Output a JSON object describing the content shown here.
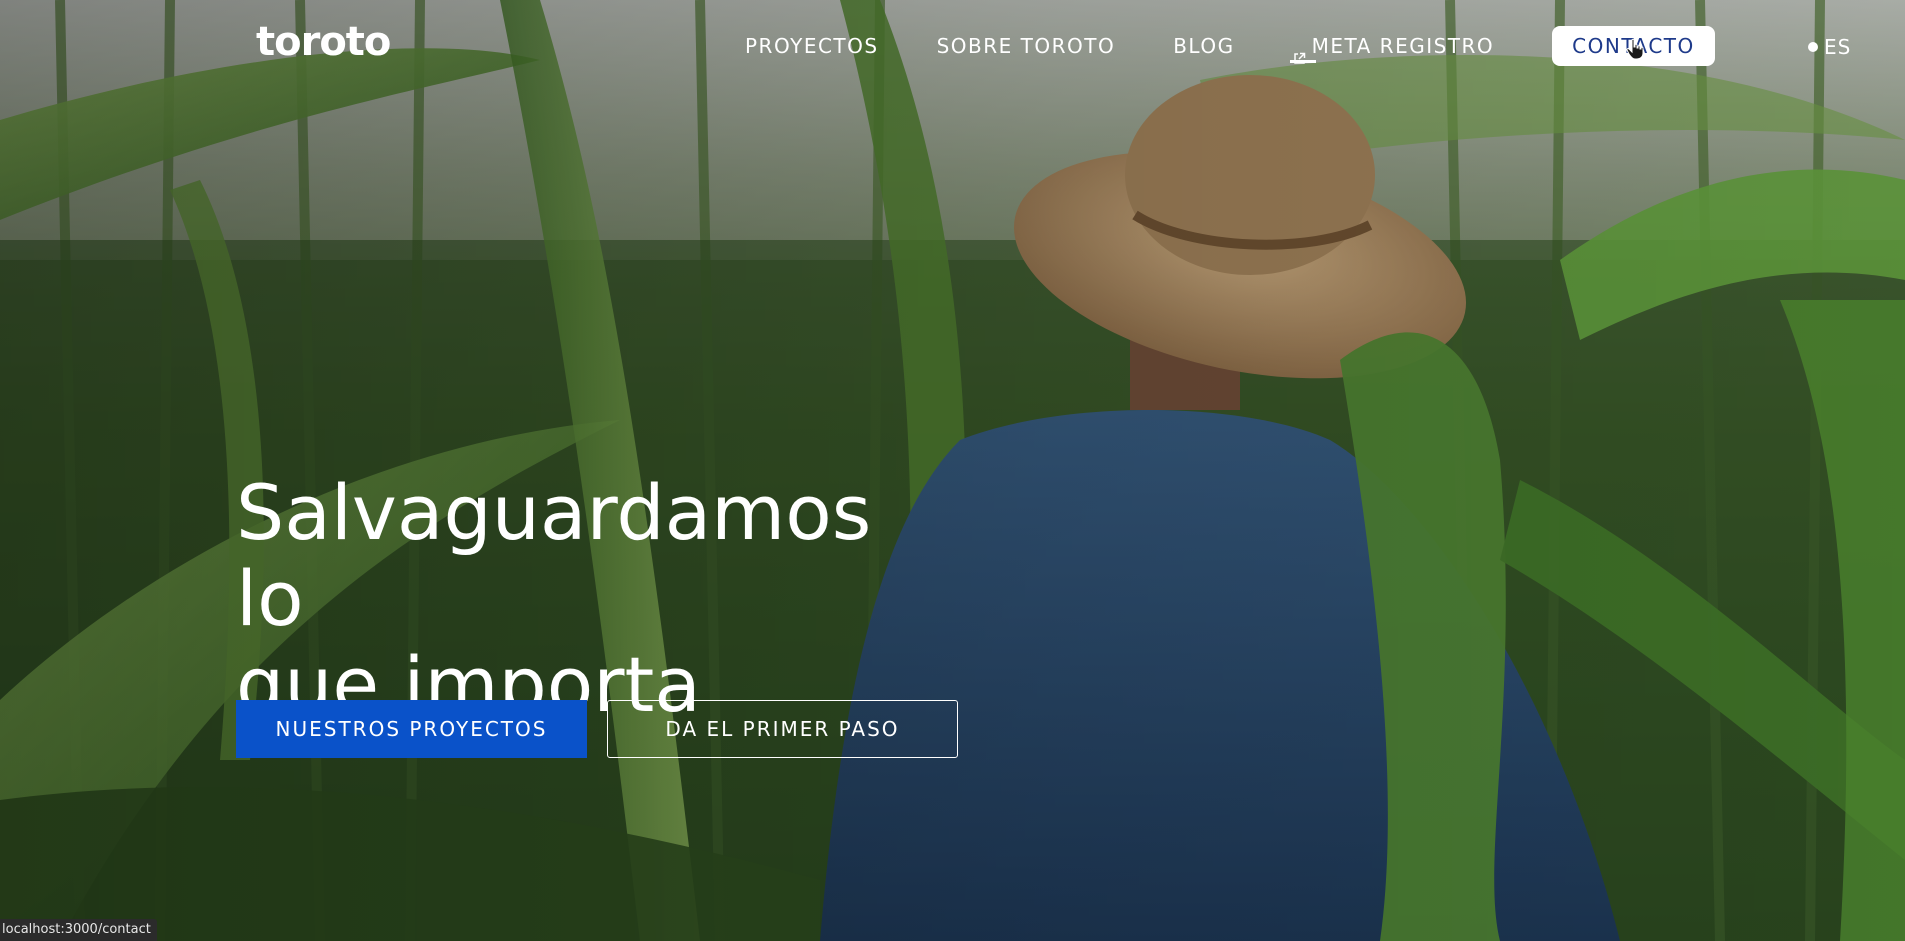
{
  "header": {
    "logo": "toroto",
    "nav": [
      {
        "label": "PROYECTOS"
      },
      {
        "label": "SOBRE TOROTO"
      },
      {
        "label": "BLOG"
      },
      {
        "label": "META REGISTRO",
        "icon": "external-link-icon"
      }
    ],
    "contact_label": "CONTACTO",
    "language": "ES"
  },
  "hero": {
    "title_line1": "Salvaguardamos lo",
    "title_line2": "que importa",
    "primary_cta": "NUESTROS PROYECTOS",
    "secondary_cta": "DA EL PRIMER PASO"
  },
  "status_bar": {
    "url": "localhost:3000/contact"
  },
  "colors": {
    "primary_button": "#0a52c9",
    "contact_text": "#1e3a8a",
    "foliage_dark": "#2e4a22",
    "shirt_blue": "#2a4a6a",
    "hat_tan": "#a88a62"
  }
}
